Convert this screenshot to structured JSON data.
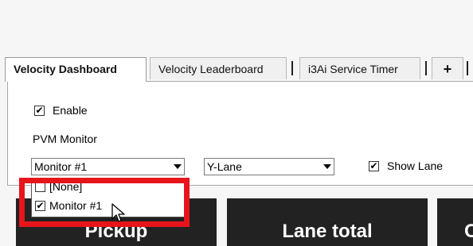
{
  "tabs": [
    {
      "label": "Velocity Dashboard",
      "active": true
    },
    {
      "label": "Velocity Leaderboard",
      "active": false
    },
    {
      "label": "i3Ai Service Timer",
      "active": false
    },
    {
      "label": "+",
      "active": false
    }
  ],
  "settings": {
    "enable_label": "Enable",
    "enable_checked": true,
    "pvm_monitor_label": "PVM Monitor",
    "monitor_selected": "Monitor #1",
    "lane_selected": "Y-Lane",
    "show_lane_label": "Show Lane",
    "show_lane_checked": true
  },
  "monitor_dropdown": {
    "options": [
      {
        "label": "[None]",
        "checked": false
      },
      {
        "label": "Monitor #1",
        "checked": true
      }
    ]
  },
  "tiles": [
    {
      "label": "Pickup"
    },
    {
      "label": "Lane total"
    },
    {
      "label": "C"
    }
  ],
  "colors": {
    "highlight": "#e8141b",
    "tile_bg": "#222222"
  },
  "icons": {
    "check": "✔",
    "cursor": "arrow-pointer"
  }
}
